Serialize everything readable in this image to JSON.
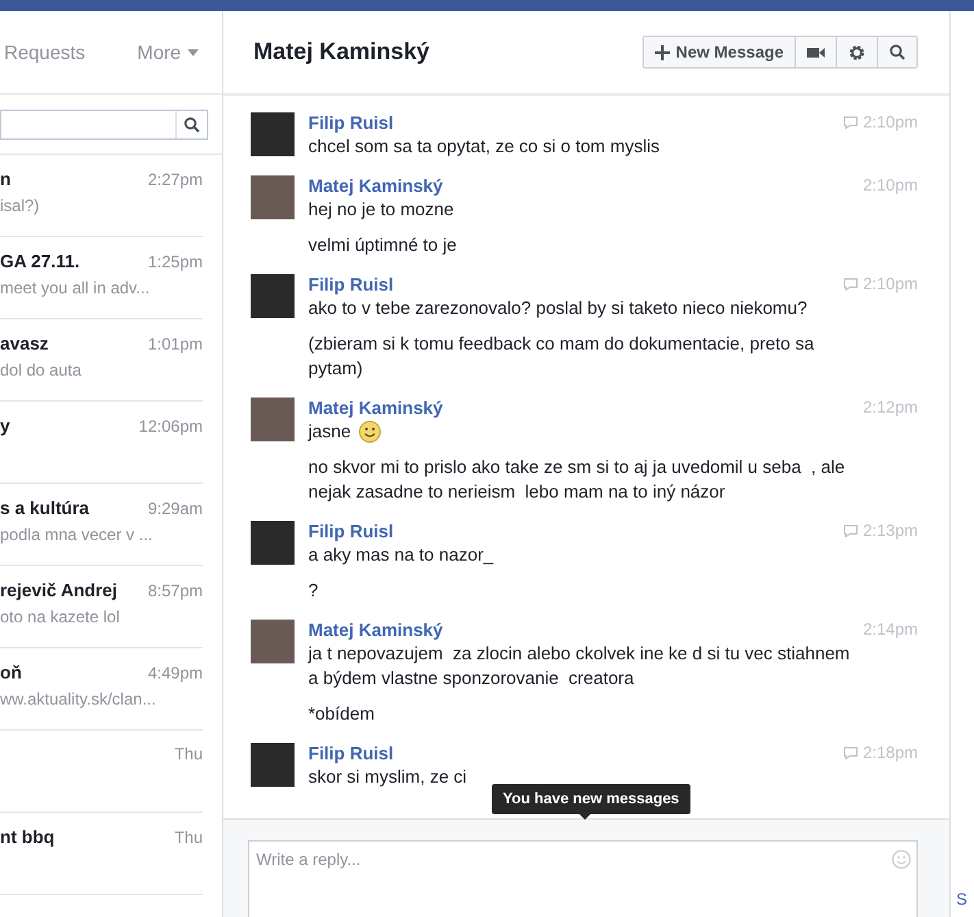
{
  "sidebar": {
    "tabs": [
      {
        "label": "Requests",
        "selected": false
      },
      {
        "label": "More",
        "selected": false
      }
    ],
    "conversations": [
      {
        "name": "n",
        "time": "2:27pm",
        "snippet": "isal?)"
      },
      {
        "name": "GA 27.11.",
        "time": "1:25pm",
        "snippet": "meet you all in adv..."
      },
      {
        "name": "avasz",
        "time": "1:01pm",
        "snippet": "dol do auta"
      },
      {
        "name": "y",
        "time": "12:06pm"
      },
      {
        "name": "s a kultúra",
        "time": "9:29am",
        "snippet": "podla mna vecer v ..."
      },
      {
        "name": "rejevič Andrej",
        "time": "8:57pm",
        "snippet": "oto na kazete lol"
      },
      {
        "name": "oň",
        "time": "4:49pm",
        "snippet": "ww.aktuality.sk/clan..."
      },
      {
        "time": "Thu"
      },
      {
        "name": "nt bbq",
        "time": "Thu"
      }
    ]
  },
  "conversation": {
    "title": "Matej Kaminský",
    "toolbar": {
      "new_message": "New Message"
    },
    "messages": [
      {
        "sender": "Filip Ruisl",
        "time": "2:10pm",
        "chat_icon": true,
        "paragraphs": [
          "chcel som sa ta opytat, ze co si o tom myslis"
        ]
      },
      {
        "sender": "Matej Kaminský",
        "time": "2:10pm",
        "chat_icon": false,
        "paragraphs": [
          "hej no je to mozne",
          "velmi úptimné to je"
        ]
      },
      {
        "sender": "Filip Ruisl",
        "time": "2:10pm",
        "chat_icon": true,
        "paragraphs": [
          "ako to v tebe zarezonovalo? poslal by si taketo nieco niekomu?",
          "(zbieram si k tomu feedback co mam do dokumentacie, preto sa pytam)"
        ]
      },
      {
        "sender": "Matej Kaminský",
        "time": "2:12pm",
        "chat_icon": false,
        "paragraphs": [
          {
            "text": "jasne",
            "smiley": true
          },
          "no skvor mi to prislo ako take ze sm si to aj ja uvedomil u seba  , ale nejak zasadne to nerieism  lebo mam na to iný názor"
        ]
      },
      {
        "sender": "Filip Ruisl",
        "time": "2:13pm",
        "chat_icon": true,
        "paragraphs": [
          "a aky mas na to nazor_",
          "?"
        ]
      },
      {
        "sender": "Matej Kaminský",
        "time": "2:14pm",
        "chat_icon": false,
        "paragraphs": [
          "ja t nepovazujem  za zlocin alebo ckolvek ine ke d si tu vec stiahnem a býdem vlastne sponzorovanie  creatora",
          "*obídem"
        ]
      },
      {
        "sender": "Filip Ruisl",
        "time": "2:18pm",
        "chat_icon": true,
        "paragraphs": [
          "skor si myslim, ze ci"
        ]
      }
    ],
    "tooltip": "You have new messages",
    "reply": {
      "placeholder": "Write a reply..."
    }
  },
  "right_column": {
    "text": "S"
  }
}
